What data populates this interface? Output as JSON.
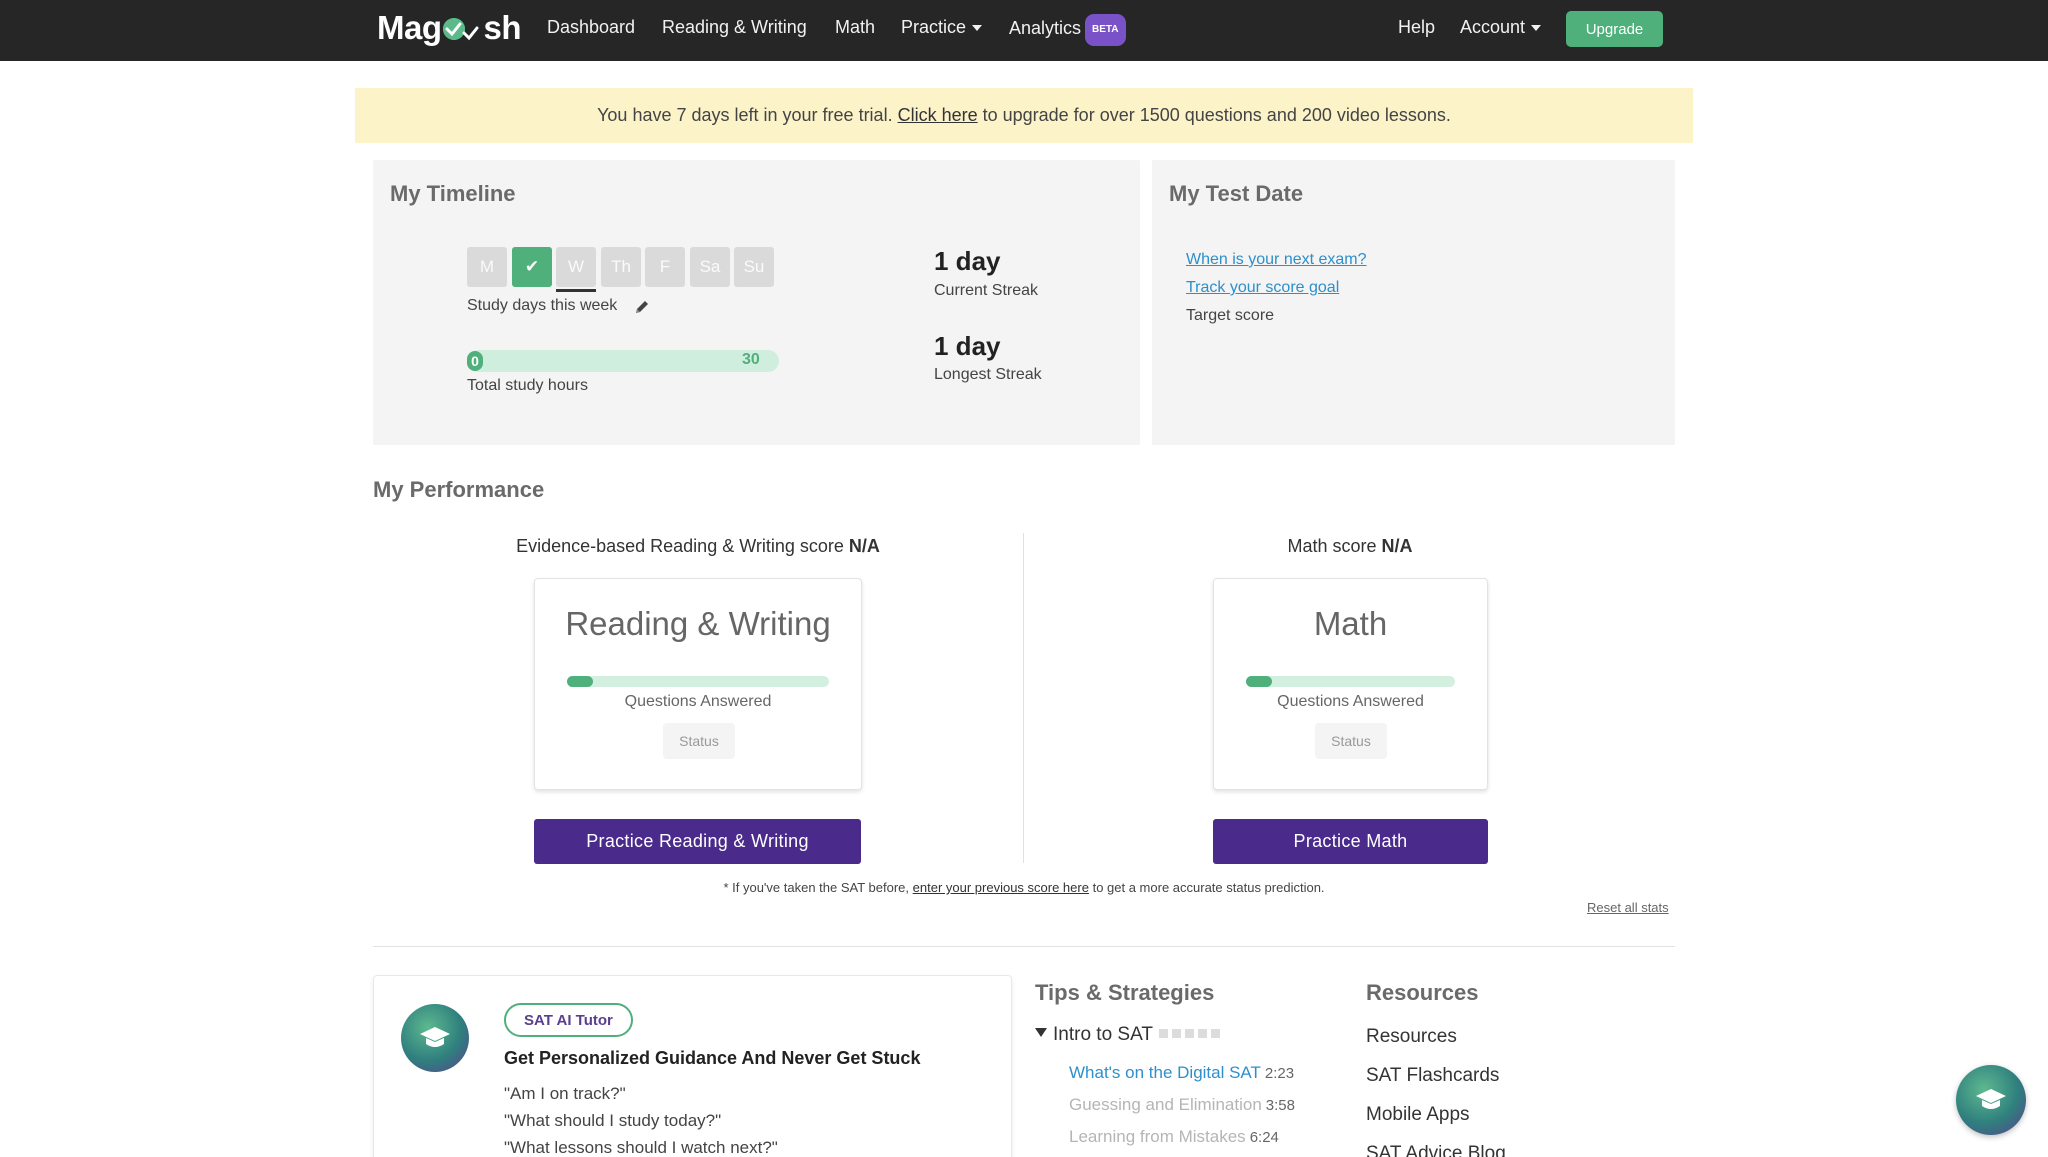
{
  "nav": {
    "logo": {
      "left": "Mag",
      "right": "sh"
    },
    "links": [
      "Dashboard",
      "Reading & Writing",
      "Math",
      "Practice",
      "Analytics"
    ],
    "analytics_badge": "BETA",
    "help": "Help",
    "account": "Account",
    "upgrade": "Upgrade"
  },
  "trial": {
    "before": "You have 7 days left in your free trial.",
    "link": "Click here",
    "after": "to upgrade for over 1500 questions and 200 video lessons."
  },
  "timeline": {
    "title": "My Timeline",
    "days": [
      {
        "label": "M",
        "done": false
      },
      {
        "label": "✔",
        "done": true
      },
      {
        "label": "W",
        "done": false
      },
      {
        "label": "Th",
        "done": false
      },
      {
        "label": "F",
        "done": false
      },
      {
        "label": "Sa",
        "done": false
      },
      {
        "label": "Su",
        "done": false
      }
    ],
    "study_days_label": "Study days this week",
    "hours_current": "0",
    "hours_goal": "30",
    "hours_label": "Total study hours",
    "current_streak": "1 day",
    "current_streak_label": "Current Streak",
    "longest_streak": "1 day",
    "longest_streak_label": "Longest Streak"
  },
  "test_date": {
    "title": "My Test Date",
    "exam_link": "When is your next exam?",
    "goal_link": "Track your score goal",
    "target_label": "Target score"
  },
  "performance": {
    "title": "My Performance",
    "rw": {
      "score_label": "Evidence-based Reading & Writing score",
      "score_value": "N/A",
      "card_title": "Reading & Writing",
      "answered_label": "Questions Answered",
      "status": "Status",
      "button": "Practice Reading & Writing"
    },
    "math": {
      "score_label": "Math score",
      "score_value": "N/A",
      "card_title": "Math",
      "answered_label": "Questions Answered",
      "status": "Status",
      "button": "Practice Math"
    },
    "footnote_before": "* If you've taken the SAT before,",
    "footnote_link": "enter your previous score here",
    "footnote_after": "to get a more accurate status prediction.",
    "reset": "Reset all stats"
  },
  "tutor": {
    "tag": "SAT AI Tutor",
    "heading": "Get Personalized Guidance And Never Get Stuck",
    "questions": [
      "\"Am I on track?\"",
      "\"What should I study today?\"",
      "\"What lessons should I watch next?\""
    ]
  },
  "tips": {
    "title": "Tips & Strategies",
    "group": "Intro to SAT",
    "lessons": [
      {
        "title": "What's on the Digital SAT",
        "duration": "2:23",
        "color": "#2d8fcc"
      },
      {
        "title": "Guessing and Elimination",
        "duration": "3:58",
        "color": "#b5b5b5"
      },
      {
        "title": "Learning from Mistakes",
        "duration": "6:24",
        "color": "#b5b5b5"
      }
    ]
  },
  "resources": {
    "title": "Resources",
    "links": [
      "Resources",
      "SAT Flashcards",
      "Mobile Apps",
      "SAT Advice Blog"
    ]
  }
}
